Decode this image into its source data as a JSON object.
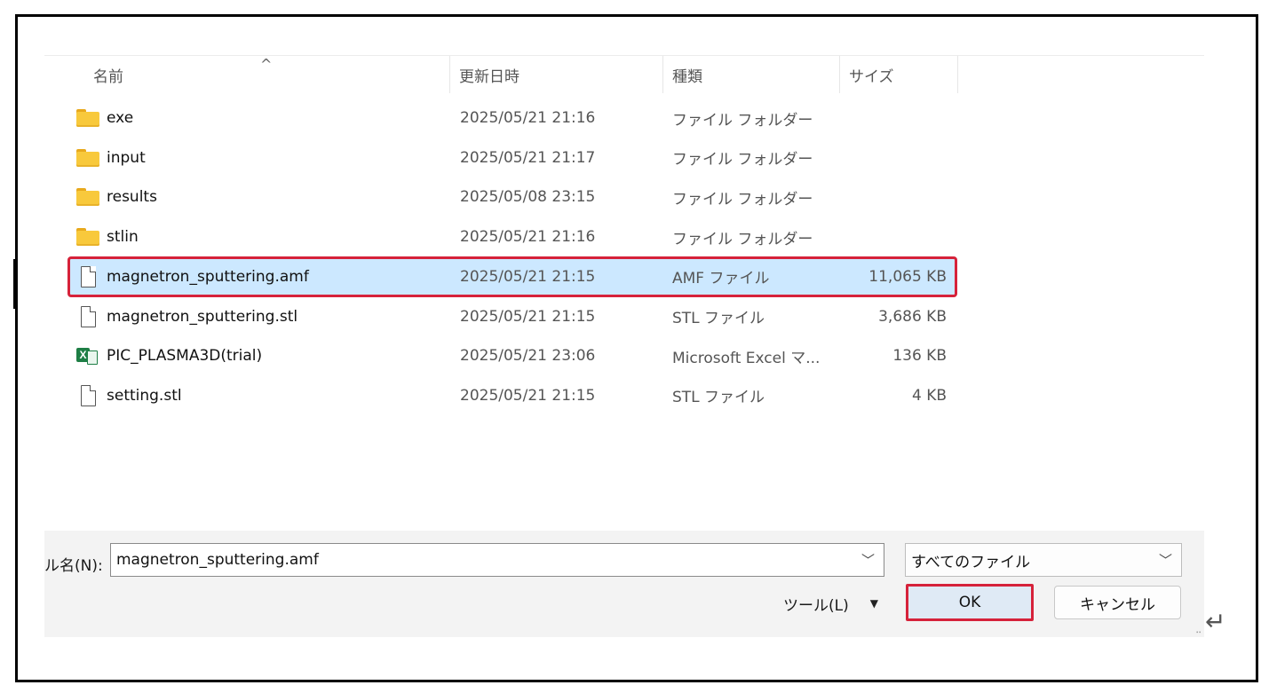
{
  "columns": {
    "name": "名前",
    "modified": "更新日時",
    "type": "種類",
    "size": "サイズ",
    "sort_caret": "^"
  },
  "rows": [
    {
      "name": "exe",
      "date": "2025/05/21 21:16",
      "type": "ファイル フォルダー",
      "size": "",
      "icon": "folder-icon"
    },
    {
      "name": "input",
      "date": "2025/05/21 21:17",
      "type": "ファイル フォルダー",
      "size": "",
      "icon": "folder-icon"
    },
    {
      "name": "results",
      "date": "2025/05/08 23:15",
      "type": "ファイル フォルダー",
      "size": "",
      "icon": "folder-icon"
    },
    {
      "name": "stlin",
      "date": "2025/05/21 21:16",
      "type": "ファイル フォルダー",
      "size": "",
      "icon": "folder-icon"
    },
    {
      "name": "magnetron_sputtering.amf",
      "date": "2025/05/21 21:15",
      "type": "AMF ファイル",
      "size": "11,065 KB",
      "icon": "file-icon",
      "selected": true
    },
    {
      "name": "magnetron_sputtering.stl",
      "date": "2025/05/21 21:15",
      "type": "STL ファイル",
      "size": "3,686 KB",
      "icon": "file-icon"
    },
    {
      "name": "PIC_PLASMA3D(trial)",
      "date": "2025/05/21 23:06",
      "type": "Microsoft Excel マ...",
      "size": "136 KB",
      "icon": "excel-icon"
    },
    {
      "name": "setting.stl",
      "date": "2025/05/21 21:15",
      "type": "STL ファイル",
      "size": "4 KB",
      "icon": "file-icon"
    }
  ],
  "footer": {
    "filename_label": "ル名(N):",
    "filename_value": "magnetron_sputtering.amf",
    "filetype_value": "すべてのファイル",
    "tools_label": "ツール(L)",
    "tools_arrow": "▼",
    "ok_label": "OK",
    "cancel_label": "キャンセル",
    "dropdown_chevron": "﹀",
    "return_mark": "↵"
  }
}
